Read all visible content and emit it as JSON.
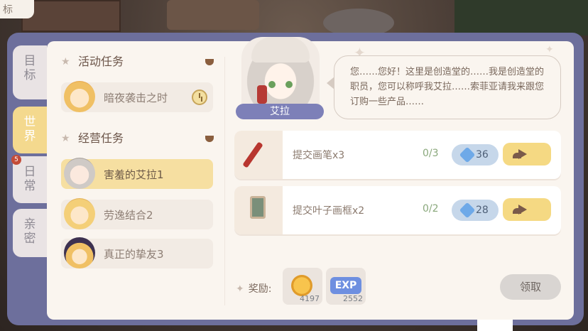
{
  "top_tab": {
    "label": "标"
  },
  "side_tabs": [
    {
      "label": "目标",
      "active": false
    },
    {
      "label": "世界",
      "active": true
    },
    {
      "label": "日常",
      "active": false,
      "badge": "5"
    },
    {
      "label": "亲密",
      "active": false
    }
  ],
  "sections": {
    "activity": {
      "title": "活动任务",
      "tasks": [
        {
          "label": "暗夜袭击之时",
          "avatar": "blonde-girl-avatar",
          "timed": true
        }
      ]
    },
    "business": {
      "title": "经营任务",
      "tasks": [
        {
          "label": "害羞的艾拉1",
          "avatar": "grey-hair-girl-avatar",
          "selected": true
        },
        {
          "label": "劳逸结合2",
          "avatar": "blonde-girl-avatar"
        },
        {
          "label": "真正的挚友3",
          "avatar": "witch-girl-avatar"
        }
      ]
    }
  },
  "npc": {
    "name": "艾拉",
    "dialogue": "您……您好！这里是创造堂的……我是创造堂的职员，您可以称呼我艾拉……索菲亚请我来跟您订购一些产品……"
  },
  "requests": [
    {
      "name": "提交画笔x3",
      "progress": "0/3",
      "cost": "36",
      "icon": "paintbrush-icon"
    },
    {
      "name": "提交叶子画框x2",
      "progress": "0/2",
      "cost": "28",
      "icon": "leaf-frame-icon"
    }
  ],
  "reward": {
    "label": "奖励:",
    "items": [
      {
        "type": "coin",
        "amount": "4197"
      },
      {
        "type": "exp",
        "icon_text": "EXP",
        "amount": "2552"
      }
    ],
    "claim_label": "领取"
  },
  "colors": {
    "frame": "#6d6f9c",
    "panel": "#faf5ef",
    "selected": "#f6dfa1",
    "go_button": "#f5d983",
    "cost_pill": "#c6d7ea",
    "name_tag": "#7d80b8"
  }
}
